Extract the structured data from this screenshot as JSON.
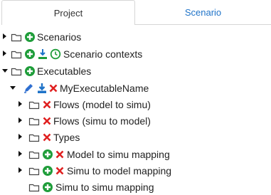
{
  "tabs": [
    {
      "label": "Project",
      "active": true
    },
    {
      "label": "Scenario",
      "active": false
    }
  ],
  "colors": {
    "accent": "#1f73c8",
    "add": "#1f9d3a",
    "remove": "#e02020",
    "edit": "#2f6fd0",
    "download": "#1f73c8",
    "folder": "#444444"
  },
  "tree": [
    {
      "label": "Scenarios",
      "expanded": false,
      "icons": [
        "folder-icon",
        "add-icon"
      ]
    },
    {
      "label": "Scenario contexts",
      "expanded": false,
      "icons": [
        "folder-icon",
        "add-icon",
        "import-icon",
        "clock-icon"
      ]
    },
    {
      "label": "Executables",
      "expanded": true,
      "icons": [
        "folder-icon",
        "add-icon"
      ]
    },
    {
      "label": "MyExecutableName",
      "expanded": true,
      "icons": [
        "edit-icon",
        "download-icon",
        "remove-icon"
      ]
    },
    {
      "label": "Flows (model to simu)",
      "expanded": false,
      "icons": [
        "folder-icon",
        "remove-icon"
      ]
    },
    {
      "label": "Flows (simu to model)",
      "expanded": false,
      "icons": [
        "folder-icon",
        "remove-icon"
      ]
    },
    {
      "label": "Types",
      "expanded": false,
      "icons": [
        "folder-icon",
        "remove-icon"
      ]
    },
    {
      "label": "Model to simu mapping",
      "expanded": false,
      "icons": [
        "folder-icon",
        "add-icon",
        "remove-icon"
      ]
    },
    {
      "label": "Simu to model mapping",
      "expanded": false,
      "icons": [
        "folder-icon",
        "add-icon",
        "remove-icon"
      ]
    },
    {
      "label": "Simu to simu mapping",
      "expanded": null,
      "icons": [
        "folder-icon",
        "add-icon"
      ]
    }
  ]
}
